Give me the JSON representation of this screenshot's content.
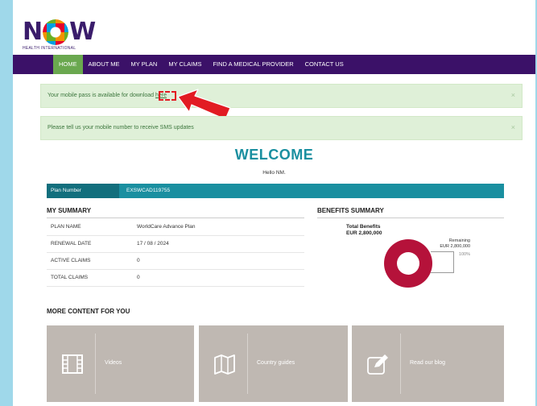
{
  "logo": {
    "word_n": "N",
    "word_w": "W",
    "sub": "HEALTH INTERNATIONAL"
  },
  "nav": {
    "items": [
      "HOME",
      "ABOUT ME",
      "MY PLAN",
      "MY CLAIMS",
      "FIND A MEDICAL PROVIDER",
      "CONTACT US"
    ]
  },
  "alerts": {
    "mobile_pass_text": "Your mobile pass is available for download ",
    "mobile_pass_link": "here",
    "sms_text": "Please tell us your mobile number to receive SMS updates",
    "close": "×"
  },
  "welcome": {
    "title": "WELCOME",
    "greeting": "Hello NM."
  },
  "plan": {
    "label": "Plan Number",
    "number": "EXSWCAD119755"
  },
  "summary": {
    "title": "MY SUMMARY",
    "rows": [
      {
        "key": "PLAN NAME",
        "value": "WorldCare Advance Plan"
      },
      {
        "key": "RENEWAL DATE",
        "value": "17 / 08 / 2024"
      },
      {
        "key": "ACTIVE CLAIMS",
        "value": "0"
      },
      {
        "key": "TOTAL CLAIMS",
        "value": "0"
      }
    ]
  },
  "benefits": {
    "title": "BENEFITS SUMMARY",
    "total_label": "Total Benefits",
    "total_value": "EUR 2,800,000",
    "remaining_label": "Remaining",
    "remaining_value": "EUR 2,800,000",
    "remaining_pct": "100%",
    "remaining_fraction": 1.0,
    "colors": {
      "donut": "#b5123a"
    }
  },
  "more": {
    "title": "MORE CONTENT FOR YOU",
    "tiles": [
      {
        "label": "Videos",
        "icon": "film-icon"
      },
      {
        "label": "Country guides",
        "icon": "map-icon"
      },
      {
        "label": "Read our blog",
        "icon": "edit-icon"
      }
    ]
  },
  "colors": {
    "nav_bg": "#3b1168",
    "nav_active": "#6aa84f",
    "teal": "#1a8fa0",
    "alert_bg": "#dff0d8",
    "highlight_red": "#e21b23"
  }
}
